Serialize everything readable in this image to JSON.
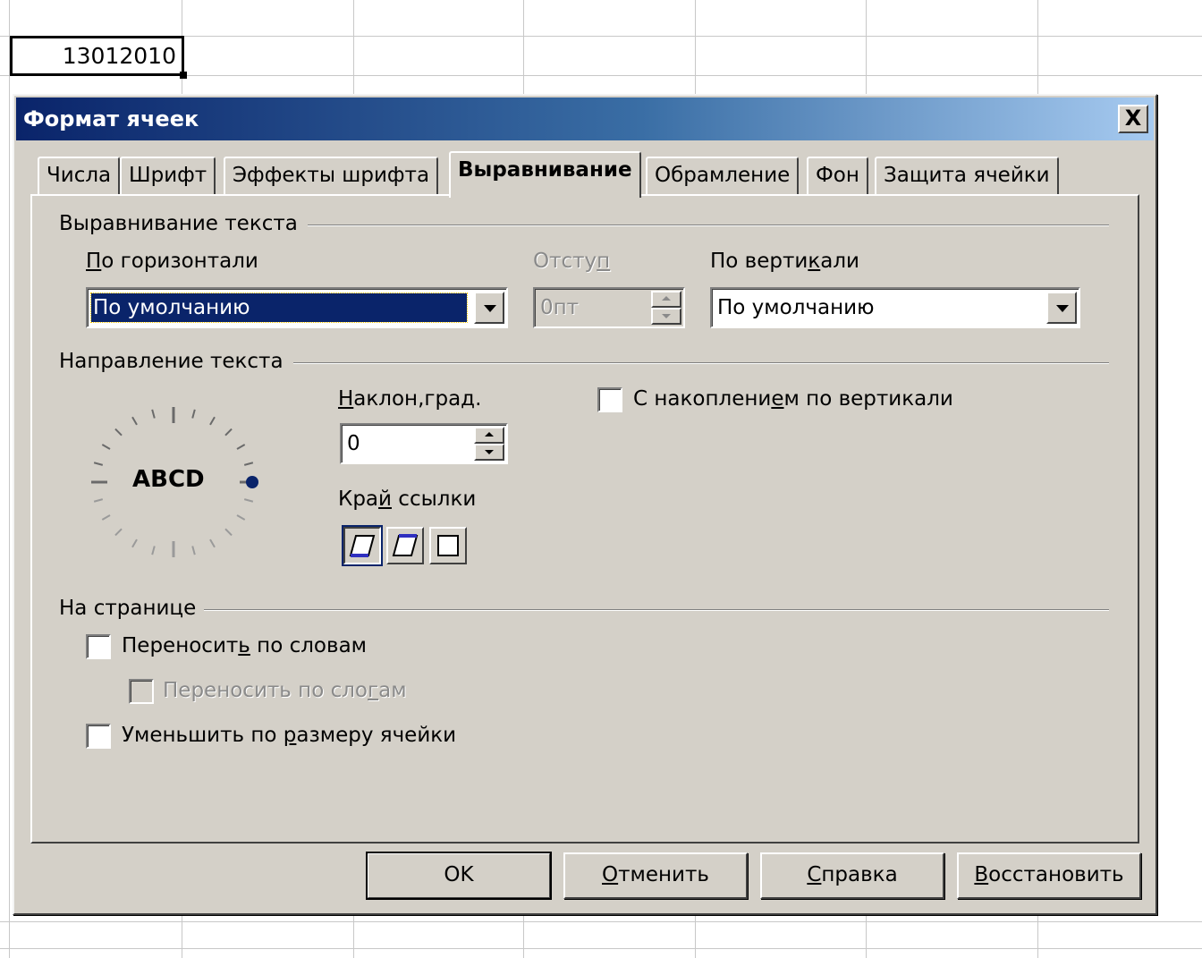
{
  "sheet": {
    "active_cell_value": "13012010"
  },
  "dialog": {
    "title": "Формат ячеек",
    "close_glyph": "X",
    "tabs": [
      {
        "label": "Числа",
        "active": false
      },
      {
        "label": "Шрифт",
        "active": false
      },
      {
        "label": "Эффекты шрифта",
        "active": false
      },
      {
        "label": "Выравнивание",
        "active": true
      },
      {
        "label": "Обрамление",
        "active": false
      },
      {
        "label": "Фон",
        "active": false
      },
      {
        "label": "Защита ячейки",
        "active": false
      }
    ],
    "text_alignment": {
      "section_label": "Выравнивание текста",
      "horizontal": {
        "label_mnemonic": "П",
        "label_rest": "о горизонтали",
        "value": "По умолчанию"
      },
      "indent": {
        "label_pre": "Отсту",
        "label_mnemonic": "п",
        "value": "0пт",
        "enabled": false
      },
      "vertical": {
        "label_pre": "По верти",
        "label_mnemonic": "к",
        "label_post": "али",
        "value": "По умолчанию"
      }
    },
    "text_direction": {
      "section_label": "Направление текста",
      "dial_text": "ABCD",
      "angle": {
        "label_mnemonic": "Н",
        "label_rest": "аклон,град.",
        "value": "0"
      },
      "stacked": {
        "label_pre": "С накоплени",
        "label_mnemonic": "е",
        "label_post": "м по вертикали",
        "checked": false
      },
      "reference_edge": {
        "label_pre": "Кра",
        "label_mnemonic": "й",
        "label_post": " ссылки",
        "selected_index": 0
      }
    },
    "properties": {
      "section_label": "На странице",
      "wrap_words": {
        "label_pre": "Переносит",
        "label_mnemonic": "ь",
        "label_post": " по словам",
        "checked": false
      },
      "hyphenation": {
        "label_pre": "Переносить по сло",
        "label_mnemonic": "г",
        "label_post": "ам",
        "checked": false,
        "enabled": false
      },
      "shrink_to_fit": {
        "label_pre": "Уменьшить по ",
        "label_mnemonic": "р",
        "label_post": "азмеру ячейки",
        "checked": false
      }
    },
    "buttons": {
      "ok": "OK",
      "cancel_mnemonic": "О",
      "cancel_rest": "тменить",
      "help_mnemonic": "С",
      "help_rest": "правка",
      "reset_mnemonic": "В",
      "reset_rest": "осстановить"
    }
  },
  "colors": {
    "dialog_bg": "#d4d0c8",
    "title_start": "#0a246a",
    "title_end": "#a6caf0",
    "selection": "#0a246a",
    "disabled_text": "#8a8a8a"
  }
}
